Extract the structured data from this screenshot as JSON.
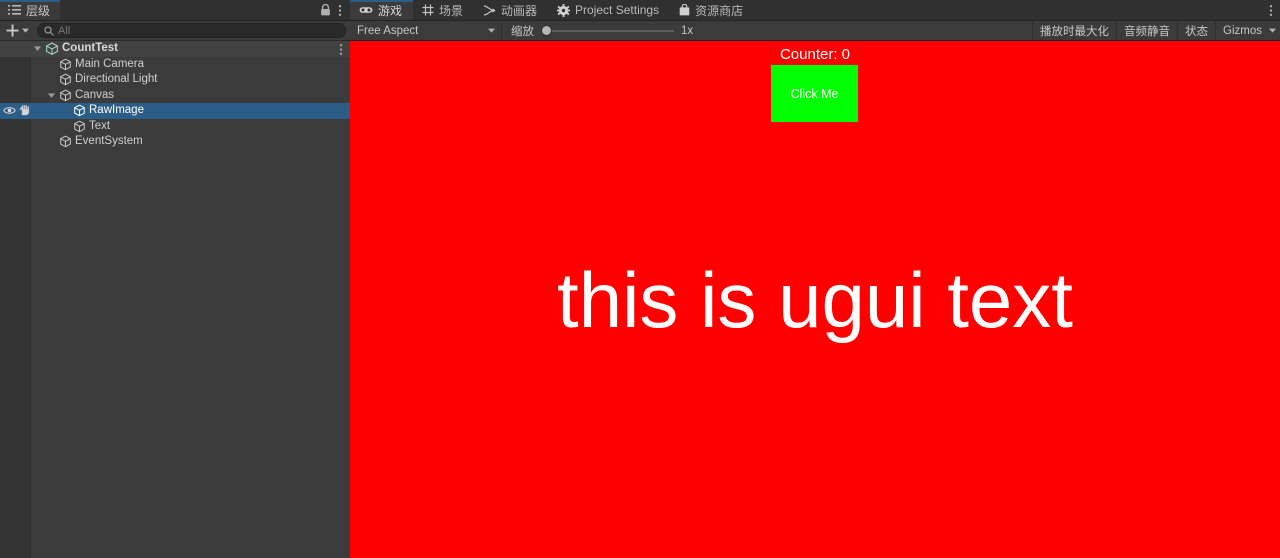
{
  "hierarchy": {
    "tab": {
      "label": "层级",
      "icon": "hierarchy-list-icon"
    },
    "header_icons": {
      "lock": "lock-icon",
      "menu": "kebab-menu-icon"
    },
    "toolbar": {
      "add_label": "+",
      "add_icon": "plus-icon",
      "add_dropdown_icon": "chevron-down-icon",
      "search_icon": "search-icon",
      "search_value": "",
      "search_placeholder": "All"
    },
    "rows": [
      {
        "label": "CountTest",
        "indent": 0,
        "icon": "unity-scene-icon",
        "expanded": true,
        "type": "scene",
        "selected": false,
        "kebab": true,
        "visibility": false
      },
      {
        "label": "Main Camera",
        "indent": 1,
        "icon": "gameobject-cube-icon",
        "expanded": null,
        "type": "gameobject",
        "selected": false,
        "kebab": false,
        "visibility": false
      },
      {
        "label": "Directional Light",
        "indent": 1,
        "icon": "gameobject-cube-icon",
        "expanded": null,
        "type": "gameobject",
        "selected": false,
        "kebab": false,
        "visibility": false
      },
      {
        "label": "Canvas",
        "indent": 1,
        "icon": "gameobject-cube-icon",
        "expanded": true,
        "type": "gameobject",
        "selected": false,
        "kebab": false,
        "visibility": false
      },
      {
        "label": "RawImage",
        "indent": 2,
        "icon": "gameobject-cube-icon",
        "expanded": null,
        "type": "gameobject",
        "selected": true,
        "kebab": false,
        "visibility": true
      },
      {
        "label": "Text",
        "indent": 2,
        "icon": "gameobject-cube-icon",
        "expanded": null,
        "type": "gameobject",
        "selected": false,
        "kebab": false,
        "visibility": false
      },
      {
        "label": "EventSystem",
        "indent": 1,
        "icon": "gameobject-cube-icon",
        "expanded": null,
        "type": "gameobject",
        "selected": false,
        "kebab": false,
        "visibility": false
      }
    ]
  },
  "gameview": {
    "tabs": [
      {
        "label": "游戏",
        "icon": "gamepad-icon",
        "active": true
      },
      {
        "label": "场景",
        "icon": "grid-scene-icon",
        "active": false
      },
      {
        "label": "动画器",
        "icon": "animator-node-icon",
        "active": false
      },
      {
        "label": "Project Settings",
        "icon": "gear-icon",
        "active": false
      },
      {
        "label": "资源商店",
        "icon": "shopping-bag-icon",
        "active": false
      }
    ],
    "tabbar_menu_icon": "kebab-menu-icon",
    "toolbar": {
      "aspect_value": "Free Aspect",
      "aspect_caret_icon": "chevron-down-icon",
      "zoom_label": "缩放",
      "zoom_value": "1x",
      "zoom_slider_percent": 0,
      "maximize_on_play": "播放时最大化",
      "mute_audio": "音频静音",
      "stats": "状态",
      "gizmos": "Gizmos",
      "gizmos_caret_icon": "chevron-down-icon"
    },
    "scene": {
      "background_color": "#ff0000",
      "counter_text": "Counter: 0",
      "button_label": "Click Me",
      "button_color": "#00ff00",
      "button_text_color": "#ffffff",
      "ugui_text": "this is ugui text",
      "ugui_text_color": "#ffffff"
    }
  }
}
